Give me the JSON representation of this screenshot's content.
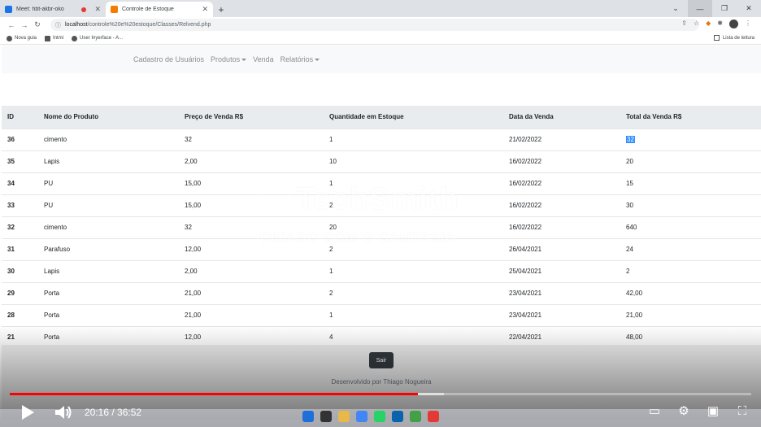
{
  "browser": {
    "tabs": [
      {
        "title": "Meet: hbt-akbr-oko",
        "active": false,
        "favicon_color": "#1a73e8"
      },
      {
        "title": "Controle de Estoque",
        "active": true,
        "favicon_color": "#f57c00"
      }
    ],
    "new_tab": "+",
    "url_host": "localhost",
    "url_path": "/controle%20e%20estoque/Classes/Relvend.php",
    "bookmarks": [
      "Nova guia",
      "Intmi",
      "User Inyerface - A..."
    ],
    "reading_list": "Lista de leitura"
  },
  "navbar": {
    "items": [
      "Cadastro de Usuários",
      "Produtos",
      "Venda",
      "Relatórios"
    ]
  },
  "table": {
    "headers": [
      "ID",
      "Nome do Produto",
      "Preço de Venda R$",
      "Quantidade em Estoque",
      "Data da Venda",
      "Total da Venda R$"
    ],
    "rows": [
      [
        "36",
        "cimento",
        "32",
        "1",
        "21/02/2022",
        "32"
      ],
      [
        "35",
        "Lapis",
        "2,00",
        "10",
        "16/02/2022",
        "20"
      ],
      [
        "34",
        "PU",
        "15,00",
        "1",
        "16/02/2022",
        "15"
      ],
      [
        "33",
        "PU",
        "15,00",
        "2",
        "16/02/2022",
        "30"
      ],
      [
        "32",
        "cimento",
        "32",
        "20",
        "16/02/2022",
        "640"
      ],
      [
        "31",
        "Parafuso",
        "12,00",
        "2",
        "26/04/2021",
        "24"
      ],
      [
        "30",
        "Lapis",
        "2,00",
        "1",
        "25/04/2021",
        "2"
      ],
      [
        "29",
        "Porta",
        "21,00",
        "2",
        "23/04/2021",
        "42,00"
      ],
      [
        "28",
        "Porta",
        "21,00",
        "1",
        "23/04/2021",
        "21,00"
      ],
      [
        "21",
        "Porta",
        "12,00",
        "4",
        "22/04/2021",
        "48,00"
      ]
    ]
  },
  "footer": {
    "logout_label": "Sair",
    "credit": "Desenvolvido por Thiago Nogueira"
  },
  "watermark": {
    "brand": "TechSmith",
    "tagline": "CRIADO COM O CAMTASIA"
  },
  "player": {
    "time": "20:16 / 36:52",
    "progress": 0.55,
    "buffered": 0.585
  }
}
